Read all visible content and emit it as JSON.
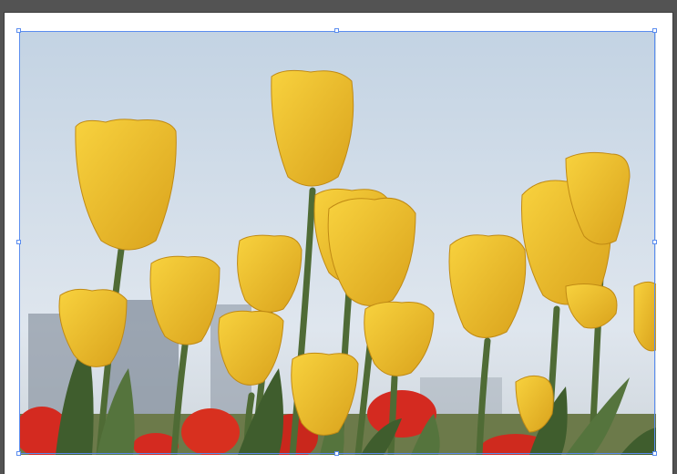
{
  "app": {
    "canvas_background": "#535353",
    "artboard_background": "#ffffff"
  },
  "selection": {
    "color": "#5b8def",
    "handles": [
      "top-left",
      "top-center",
      "top-right",
      "middle-left",
      "middle-right",
      "bottom-left",
      "bottom-center",
      "bottom-right"
    ]
  },
  "image": {
    "subject": "tulips",
    "palette": {
      "sky": "#c9d7e4",
      "tulip_yellow": "#f2c02c",
      "tulip_red": "#d42a20",
      "stem_green": "#4f6b35"
    }
  }
}
